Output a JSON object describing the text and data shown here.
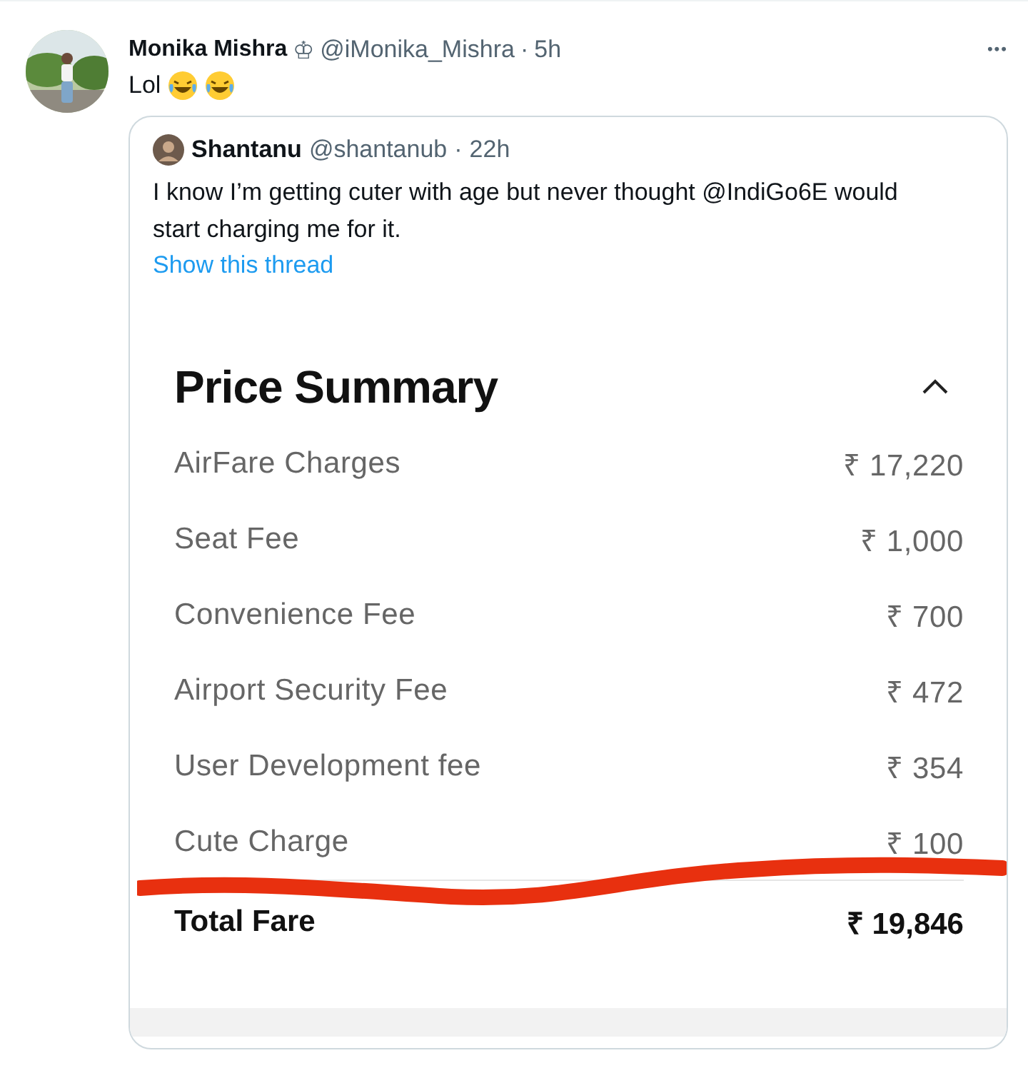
{
  "tweet": {
    "name": "Monika Mishra",
    "badge": "♔",
    "handle": "@iMonika_Mishra",
    "dot": "·",
    "time": "5h",
    "text": "Lol",
    "more": "•••"
  },
  "quote": {
    "name": "Shantanu",
    "handle": "@shantanub",
    "dot": "·",
    "time": "22h",
    "text": "I know I’m getting cuter with age but never thought @IndiGo6E would start charging me for it.",
    "thread_link": "Show this thread"
  },
  "price_summary": {
    "title": "Price Summary",
    "expanded": true,
    "rows": [
      {
        "label": "AirFare Charges",
        "amount": "₹ 17,220"
      },
      {
        "label": "Seat Fee",
        "amount": "₹ 1,000"
      },
      {
        "label": "Convenience Fee",
        "amount": "₹ 700"
      },
      {
        "label": "Airport Security Fee",
        "amount": "₹ 472"
      },
      {
        "label": "User Development fee",
        "amount": "₹ 354"
      },
      {
        "label": "Cute Charge",
        "amount": "₹ 100"
      }
    ],
    "total": {
      "label": "Total Fare",
      "amount": "₹ 19,846"
    }
  }
}
